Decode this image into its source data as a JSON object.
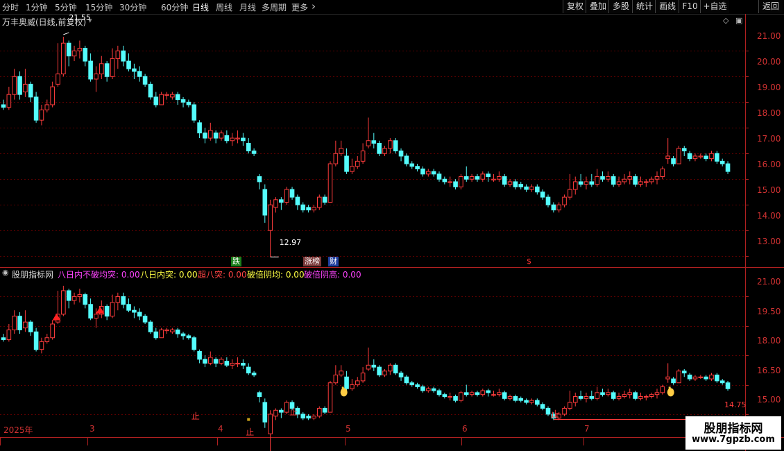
{
  "toolbar": {
    "timeframes": [
      "分时",
      "1分钟",
      "5分钟",
      "15分钟",
      "30分钟",
      "60分钟",
      "日线",
      "周线",
      "月线",
      "多周期",
      "更多"
    ],
    "active": "日线",
    "right_buttons": [
      "复权",
      "叠加",
      "多股",
      "统计",
      "画线",
      "F10",
      "+自选",
      "返回"
    ]
  },
  "main": {
    "title": "万丰奥威(日线,前复权)",
    "high_label": "21.55",
    "low_label": "12.97",
    "y_ticks": [
      "21.00",
      "20.00",
      "19.00",
      "18.00",
      "17.00",
      "16.00",
      "15.00",
      "14.00",
      "13.00"
    ],
    "markers": [
      {
        "text": "跌",
        "bg": "#1b7f1b",
        "fg": "#ffffff"
      },
      {
        "text": "涨榜",
        "bg": "#7a3a3a",
        "fg": "#ffffff"
      },
      {
        "text": "财",
        "bg": "#1f3fa0",
        "fg": "#ffffff"
      },
      {
        "text": "$",
        "bg": "",
        "fg": "#ff3333"
      }
    ]
  },
  "indicator": {
    "name": "股朋指标网",
    "items": [
      {
        "label": "八日内不破均突: 0.00",
        "color": "#ff44ff"
      },
      {
        "label": "八日内突: 0.00",
        "color": "#ffff44"
      },
      {
        "label": "超八突: 0.00",
        "color": "#ff4444"
      },
      {
        "label": "破倍阴均: 0.00",
        "color": "#ffff44"
      },
      {
        "label": "破倍阴高: 0.00",
        "color": "#ff44ff"
      }
    ],
    "y_ticks": [
      "21.00",
      "19.50",
      "18.00",
      "16.50",
      "15.00"
    ],
    "stop_label": "止",
    "level_label": "14.75"
  },
  "date_axis": [
    "2025年",
    "3",
    "4",
    "5",
    "6",
    "7"
  ],
  "watermark": {
    "line1": "股朋指标网",
    "line2": "www.7gpzb.com"
  },
  "colors": {
    "up": "#ff3c3c",
    "down": "#54fcfc",
    "grid": "#5a0000",
    "axis": "#b02020",
    "bg": "#000000"
  },
  "chart_data": {
    "type": "candlestick",
    "ylim_main": [
      12.6,
      21.9
    ],
    "ylim_indicator": [
      13.9,
      21.9
    ],
    "candles": [
      [
        18.9,
        18.8,
        19.1,
        18.7
      ],
      [
        18.8,
        19.3,
        19.6,
        18.7
      ],
      [
        19.3,
        20.0,
        20.3,
        19.1
      ],
      [
        20.0,
        19.3,
        20.2,
        19.1
      ],
      [
        19.4,
        19.7,
        20.3,
        19.2
      ],
      [
        19.7,
        19.2,
        19.8,
        19.0
      ],
      [
        19.2,
        18.3,
        19.4,
        18.2
      ],
      [
        18.3,
        18.7,
        18.9,
        18.1
      ],
      [
        18.7,
        18.9,
        19.1,
        18.6
      ],
      [
        18.9,
        19.6,
        19.8,
        18.8
      ],
      [
        19.7,
        20.1,
        21.3,
        19.6
      ],
      [
        20.1,
        21.3,
        21.55,
        20.0
      ],
      [
        21.3,
        20.8,
        21.4,
        20.4
      ],
      [
        20.8,
        21.0,
        21.2,
        20.6
      ],
      [
        21.0,
        21.1,
        21.4,
        20.7
      ],
      [
        21.1,
        20.6,
        21.2,
        20.4
      ],
      [
        20.6,
        19.9,
        20.9,
        19.8
      ],
      [
        19.9,
        20.1,
        20.4,
        19.4
      ],
      [
        20.1,
        20.5,
        20.8,
        19.9
      ],
      [
        20.5,
        20.0,
        20.6,
        19.8
      ],
      [
        20.0,
        20.7,
        21.1,
        19.9
      ],
      [
        20.7,
        21.0,
        21.2,
        20.3
      ],
      [
        21.0,
        20.6,
        21.2,
        20.4
      ],
      [
        20.6,
        20.3,
        20.9,
        20.2
      ],
      [
        20.3,
        20.2,
        20.5,
        19.9
      ],
      [
        20.2,
        20.0,
        20.4,
        19.8
      ],
      [
        20.0,
        19.7,
        20.1,
        19.6
      ],
      [
        19.7,
        19.2,
        19.8,
        19.1
      ],
      [
        19.2,
        18.9,
        19.4,
        18.8
      ],
      [
        18.9,
        19.3,
        19.4,
        18.9
      ],
      [
        19.3,
        19.3,
        19.4,
        19.1
      ],
      [
        19.2,
        19.3,
        19.4,
        19.1
      ],
      [
        19.3,
        19.1,
        19.4,
        18.9
      ],
      [
        19.1,
        19.0,
        19.2,
        18.8
      ],
      [
        19.0,
        18.9,
        19.1,
        18.8
      ],
      [
        18.9,
        18.3,
        19.0,
        18.2
      ],
      [
        18.2,
        17.8,
        18.3,
        17.6
      ],
      [
        17.8,
        17.6,
        18.0,
        17.4
      ],
      [
        17.6,
        17.9,
        18.2,
        17.5
      ],
      [
        17.8,
        17.6,
        17.9,
        17.4
      ],
      [
        17.6,
        17.8,
        17.9,
        17.5
      ],
      [
        17.7,
        17.5,
        17.9,
        17.4
      ],
      [
        17.5,
        17.6,
        17.8,
        17.3
      ],
      [
        17.6,
        17.6,
        17.9,
        17.4
      ],
      [
        17.6,
        17.5,
        17.8,
        17.3
      ],
      [
        17.4,
        17.1,
        17.6,
        17.0
      ],
      [
        17.1,
        17.0,
        17.2,
        16.9
      ],
      [
        16.1,
        15.9,
        16.2,
        15.6
      ],
      [
        15.6,
        14.6,
        15.8,
        14.3
      ],
      [
        14.0,
        15.0,
        15.2,
        12.97
      ],
      [
        14.9,
        15.2,
        15.3,
        14.7
      ],
      [
        15.2,
        15.1,
        15.3,
        14.8
      ],
      [
        15.1,
        15.6,
        15.7,
        15.0
      ],
      [
        15.6,
        15.3,
        15.7,
        15.2
      ],
      [
        15.3,
        15.0,
        15.4,
        14.8
      ],
      [
        15.0,
        14.8,
        15.1,
        14.7
      ],
      [
        14.9,
        14.8,
        15.0,
        14.7
      ],
      [
        14.8,
        14.9,
        15.0,
        14.7
      ],
      [
        14.9,
        15.3,
        15.4,
        14.8
      ],
      [
        15.3,
        15.1,
        15.4,
        15.0
      ],
      [
        15.1,
        16.6,
        16.7,
        15.1
      ],
      [
        16.6,
        17.0,
        17.5,
        16.5
      ],
      [
        17.0,
        17.2,
        17.5,
        16.9
      ],
      [
        16.9,
        16.3,
        17.2,
        16.2
      ],
      [
        16.3,
        16.5,
        16.8,
        16.2
      ],
      [
        16.5,
        16.7,
        16.9,
        16.4
      ],
      [
        16.7,
        17.1,
        17.4,
        16.6
      ],
      [
        17.3,
        17.5,
        18.4,
        17.2
      ],
      [
        17.5,
        17.4,
        17.8,
        17.2
      ],
      [
        17.4,
        17.0,
        17.5,
        16.9
      ],
      [
        17.0,
        17.2,
        17.3,
        16.9
      ],
      [
        17.2,
        17.5,
        17.6,
        17.0
      ],
      [
        17.5,
        17.1,
        17.6,
        17.0
      ],
      [
        17.1,
        16.9,
        17.2,
        16.7
      ],
      [
        16.9,
        16.6,
        17.0,
        16.5
      ],
      [
        16.6,
        16.5,
        16.7,
        16.4
      ],
      [
        16.5,
        16.4,
        16.6,
        16.3
      ],
      [
        16.4,
        16.2,
        16.5,
        16.1
      ],
      [
        16.2,
        16.3,
        16.4,
        16.1
      ],
      [
        16.3,
        16.2,
        16.4,
        16.1
      ],
      [
        16.2,
        16.0,
        16.3,
        15.9
      ],
      [
        16.0,
        15.9,
        16.1,
        15.8
      ],
      [
        15.9,
        15.9,
        16.1,
        15.7
      ],
      [
        15.9,
        15.7,
        16.0,
        15.6
      ],
      [
        15.7,
        16.1,
        16.2,
        15.6
      ],
      [
        16.1,
        16.0,
        16.5,
        15.9
      ],
      [
        16.0,
        16.1,
        16.2,
        15.9
      ],
      [
        16.1,
        16.0,
        16.2,
        15.9
      ],
      [
        16.0,
        16.2,
        16.3,
        15.9
      ],
      [
        16.2,
        16.1,
        16.3,
        15.9
      ],
      [
        16.0,
        16.0,
        16.2,
        15.9
      ],
      [
        16.0,
        16.1,
        16.3,
        15.9
      ],
      [
        16.1,
        15.8,
        16.2,
        15.7
      ],
      [
        15.8,
        15.9,
        16.0,
        15.7
      ],
      [
        15.9,
        15.7,
        16.0,
        15.6
      ],
      [
        15.8,
        15.7,
        15.9,
        15.6
      ],
      [
        15.7,
        15.6,
        15.8,
        15.5
      ],
      [
        15.6,
        15.7,
        15.8,
        15.5
      ],
      [
        15.7,
        15.5,
        15.8,
        15.4
      ],
      [
        15.5,
        15.3,
        15.6,
        15.2
      ],
      [
        15.3,
        15.0,
        15.4,
        14.9
      ],
      [
        15.0,
        14.8,
        15.1,
        14.7
      ],
      [
        14.8,
        15.0,
        15.1,
        14.7
      ],
      [
        15.0,
        15.3,
        15.4,
        14.9
      ],
      [
        15.3,
        15.6,
        16.2,
        15.2
      ],
      [
        15.6,
        15.9,
        16.1,
        15.4
      ],
      [
        15.9,
        15.8,
        16.2,
        15.7
      ],
      [
        15.8,
        15.9,
        16.1,
        15.6
      ],
      [
        15.9,
        15.8,
        16.2,
        15.7
      ],
      [
        15.8,
        16.1,
        16.4,
        15.7
      ],
      [
        16.1,
        16.0,
        16.3,
        15.9
      ],
      [
        16.0,
        16.1,
        16.3,
        15.9
      ],
      [
        16.1,
        15.8,
        16.2,
        15.7
      ],
      [
        15.8,
        15.9,
        16.1,
        15.7
      ],
      [
        15.9,
        16.0,
        16.2,
        15.8
      ],
      [
        16.0,
        16.1,
        16.3,
        15.8
      ],
      [
        16.1,
        15.8,
        16.2,
        15.7
      ],
      [
        15.8,
        15.9,
        16.1,
        15.7
      ],
      [
        15.9,
        15.9,
        16.0,
        15.7
      ],
      [
        15.9,
        16.0,
        16.1,
        15.8
      ],
      [
        16.0,
        16.1,
        16.3,
        15.8
      ],
      [
        16.1,
        16.4,
        16.5,
        16.0
      ],
      [
        16.8,
        16.9,
        17.6,
        16.6
      ],
      [
        16.8,
        16.6,
        16.9,
        16.5
      ],
      [
        16.6,
        17.2,
        17.3,
        16.6
      ],
      [
        17.2,
        17.1,
        17.3,
        16.9
      ],
      [
        17.0,
        16.8,
        17.1,
        16.7
      ],
      [
        16.8,
        16.9,
        17.0,
        16.7
      ],
      [
        16.9,
        16.9,
        17.0,
        16.8
      ],
      [
        16.9,
        16.8,
        17.0,
        16.7
      ],
      [
        16.8,
        17.0,
        17.1,
        16.7
      ],
      [
        17.0,
        16.7,
        17.1,
        16.6
      ],
      [
        16.7,
        16.6,
        16.8,
        16.5
      ],
      [
        16.6,
        16.3,
        16.7,
        16.2
      ]
    ]
  }
}
